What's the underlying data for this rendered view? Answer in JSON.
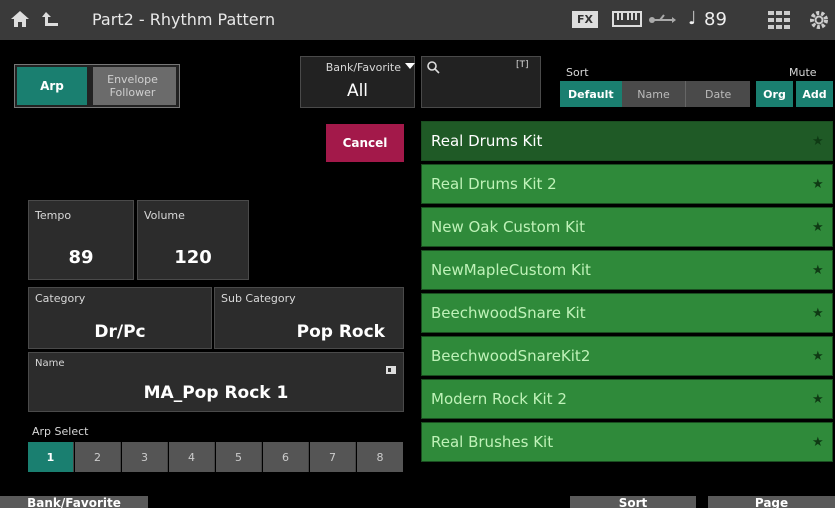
{
  "header": {
    "title": "Part2 - Rhythm Pattern",
    "fx_label": "FX",
    "tempo_display": "89"
  },
  "mode_buttons": {
    "arp": "Arp",
    "envelope_follower": "Envelope Follower"
  },
  "bank_favorite": {
    "label": "Bank/Favorite",
    "value": "All"
  },
  "search": {
    "value": "",
    "text_indicator": "[T]"
  },
  "sort": {
    "label": "Sort",
    "options": [
      "Default",
      "Name",
      "Date"
    ],
    "selected": "Default"
  },
  "mute": {
    "label": "Mute",
    "options": [
      "Org",
      "Add"
    ]
  },
  "cancel_label": "Cancel",
  "tempo": {
    "label": "Tempo",
    "value": "89"
  },
  "volume": {
    "label": "Volume",
    "value": "120"
  },
  "category": {
    "label": "Category",
    "value": "Dr/Pc"
  },
  "sub_category": {
    "label": "Sub Category",
    "value": "Pop Rock"
  },
  "name": {
    "label": "Name",
    "value": "MA_Pop Rock 1"
  },
  "arp_select": {
    "label": "Arp Select",
    "buttons": [
      "1",
      "2",
      "3",
      "4",
      "5",
      "6",
      "7",
      "8"
    ],
    "selected": "1"
  },
  "kit_list": [
    "Real Drums Kit",
    "Real Drums Kit 2",
    "New Oak Custom Kit",
    "NewMapleCustom Kit",
    "BeechwoodSnare Kit",
    "BeechwoodSnareKit2",
    "Modern Rock Kit 2",
    "Real Brushes Kit"
  ],
  "bottom_bar": {
    "bank_favorite": "Bank/Favorite",
    "sort": "Sort",
    "page": "Page"
  },
  "colors": {
    "accent_teal": "#1a7f70",
    "list_green": "#2f8a3a",
    "cancel_red": "#a3194a"
  }
}
